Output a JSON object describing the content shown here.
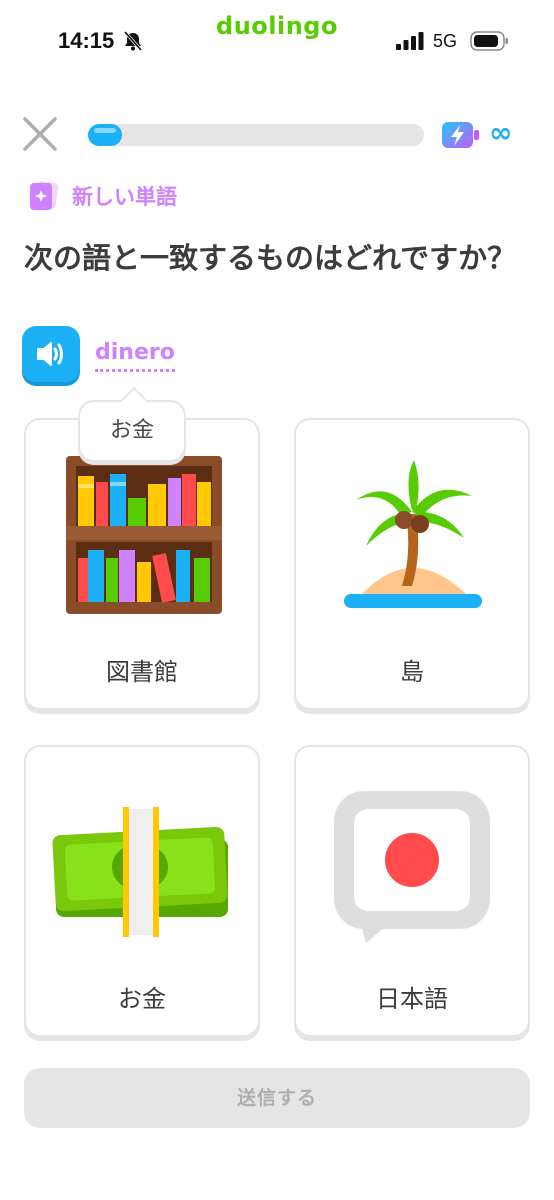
{
  "status_bar": {
    "time": "14:15",
    "app_name": "duolingo",
    "network": "5G",
    "icons": [
      "bell-slash-icon",
      "signal-bars-icon",
      "battery-icon"
    ]
  },
  "lesson": {
    "progress_fraction": 0.1,
    "energy_value": "∞",
    "new_word_label": "新しい単語",
    "question": "次の語と一致するものはどれですか？",
    "target_word": "dinero",
    "tooltip": "お金"
  },
  "choices": [
    {
      "label": "図書館",
      "icon": "bookshelf-icon"
    },
    {
      "label": "島",
      "icon": "island-icon"
    },
    {
      "label": "お金",
      "icon": "money-icon"
    },
    {
      "label": "日本語",
      "icon": "japan-flag-icon"
    }
  ],
  "submit_label": "送信する",
  "colors": {
    "brand_green": "#58cc02",
    "accent_blue": "#1cb0f6",
    "accent_purple": "#ce82ff",
    "disabled_gray": "#e5e5e5"
  }
}
